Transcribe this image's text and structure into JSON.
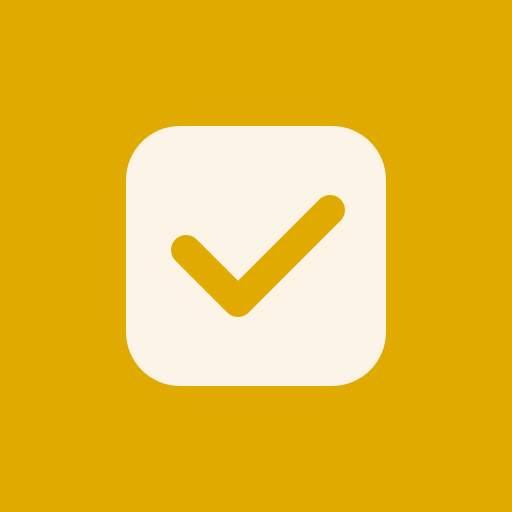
{
  "app_icon": {
    "name": "checkbox-checked",
    "state": "checked",
    "icon": "check-icon"
  },
  "colors": {
    "background": "#E1AA00",
    "tile": "#FCF4E6",
    "check": "#E1AA00"
  }
}
